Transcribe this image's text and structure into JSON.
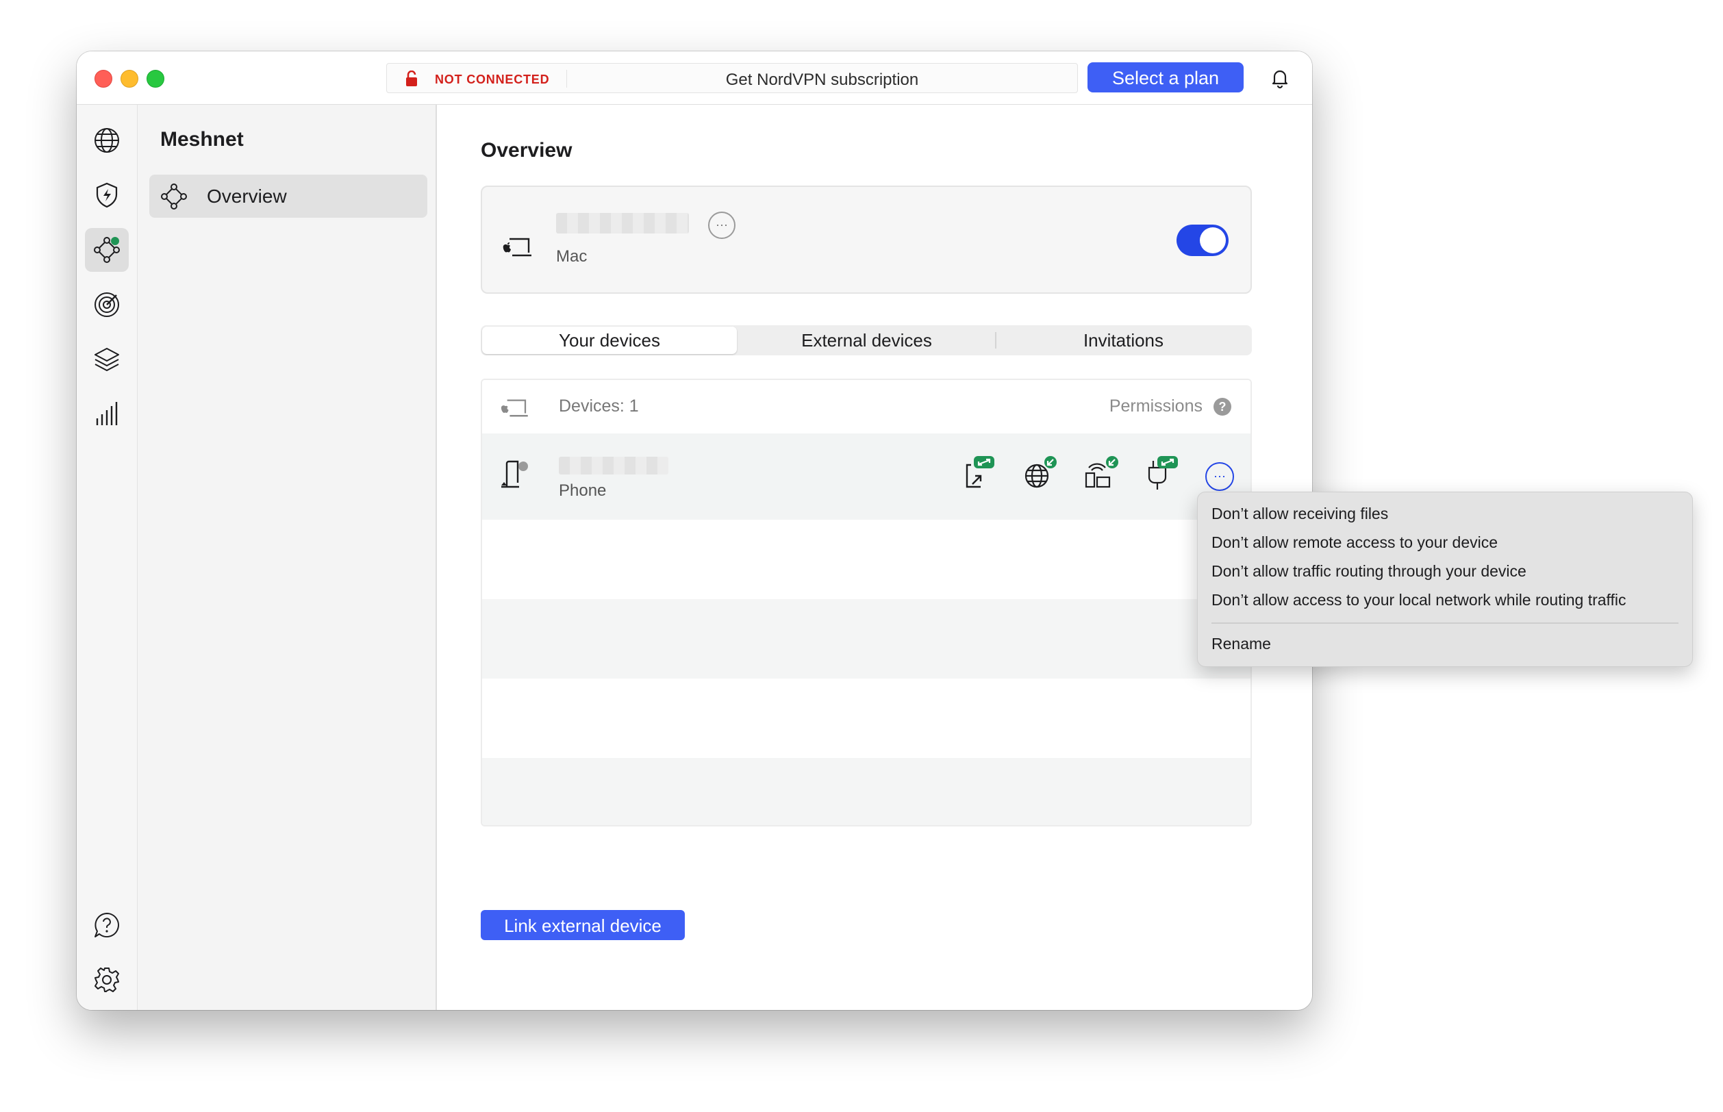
{
  "titlebar": {
    "status": "NOT CONNECTED",
    "subscription": "Get NordVPN subscription",
    "plan_button": "Select a plan"
  },
  "rail": {
    "icons": [
      "globe-icon",
      "threat-protection-icon",
      "meshnet-icon",
      "target-icon",
      "layers-icon",
      "stats-icon",
      "help-chat-icon",
      "settings-gear-icon"
    ],
    "active": "meshnet-icon"
  },
  "sidebar": {
    "title": "Meshnet",
    "items": [
      {
        "label": "Overview",
        "icon": "meshnet-icon"
      }
    ]
  },
  "main": {
    "title": "Overview",
    "this_device": {
      "type": "Mac",
      "meshnet_enabled": true
    },
    "tabs": [
      {
        "label": "Your devices",
        "selected": true
      },
      {
        "label": "External devices",
        "selected": false
      },
      {
        "label": "Invitations",
        "selected": false
      }
    ],
    "devices_count": "Devices: 1",
    "permissions_label": "Permissions",
    "help": "?",
    "devices": [
      {
        "type": "Phone",
        "permissions": [
          "file-sharing-icon",
          "remote-access-icon",
          "traffic-routing-icon",
          "local-network-icon"
        ]
      }
    ],
    "link_button": "Link external device"
  },
  "context_menu": {
    "items": [
      "Don’t allow receiving files",
      "Don’t allow remote access to your device",
      "Don’t allow traffic routing through your device",
      "Don’t allow access to your local network while routing traffic",
      "Rename"
    ]
  },
  "colors": {
    "accent": "#3e5ff5",
    "toggle": "#2446e6",
    "not_connected": "#d3201b",
    "permission_badge": "#1f9455"
  }
}
